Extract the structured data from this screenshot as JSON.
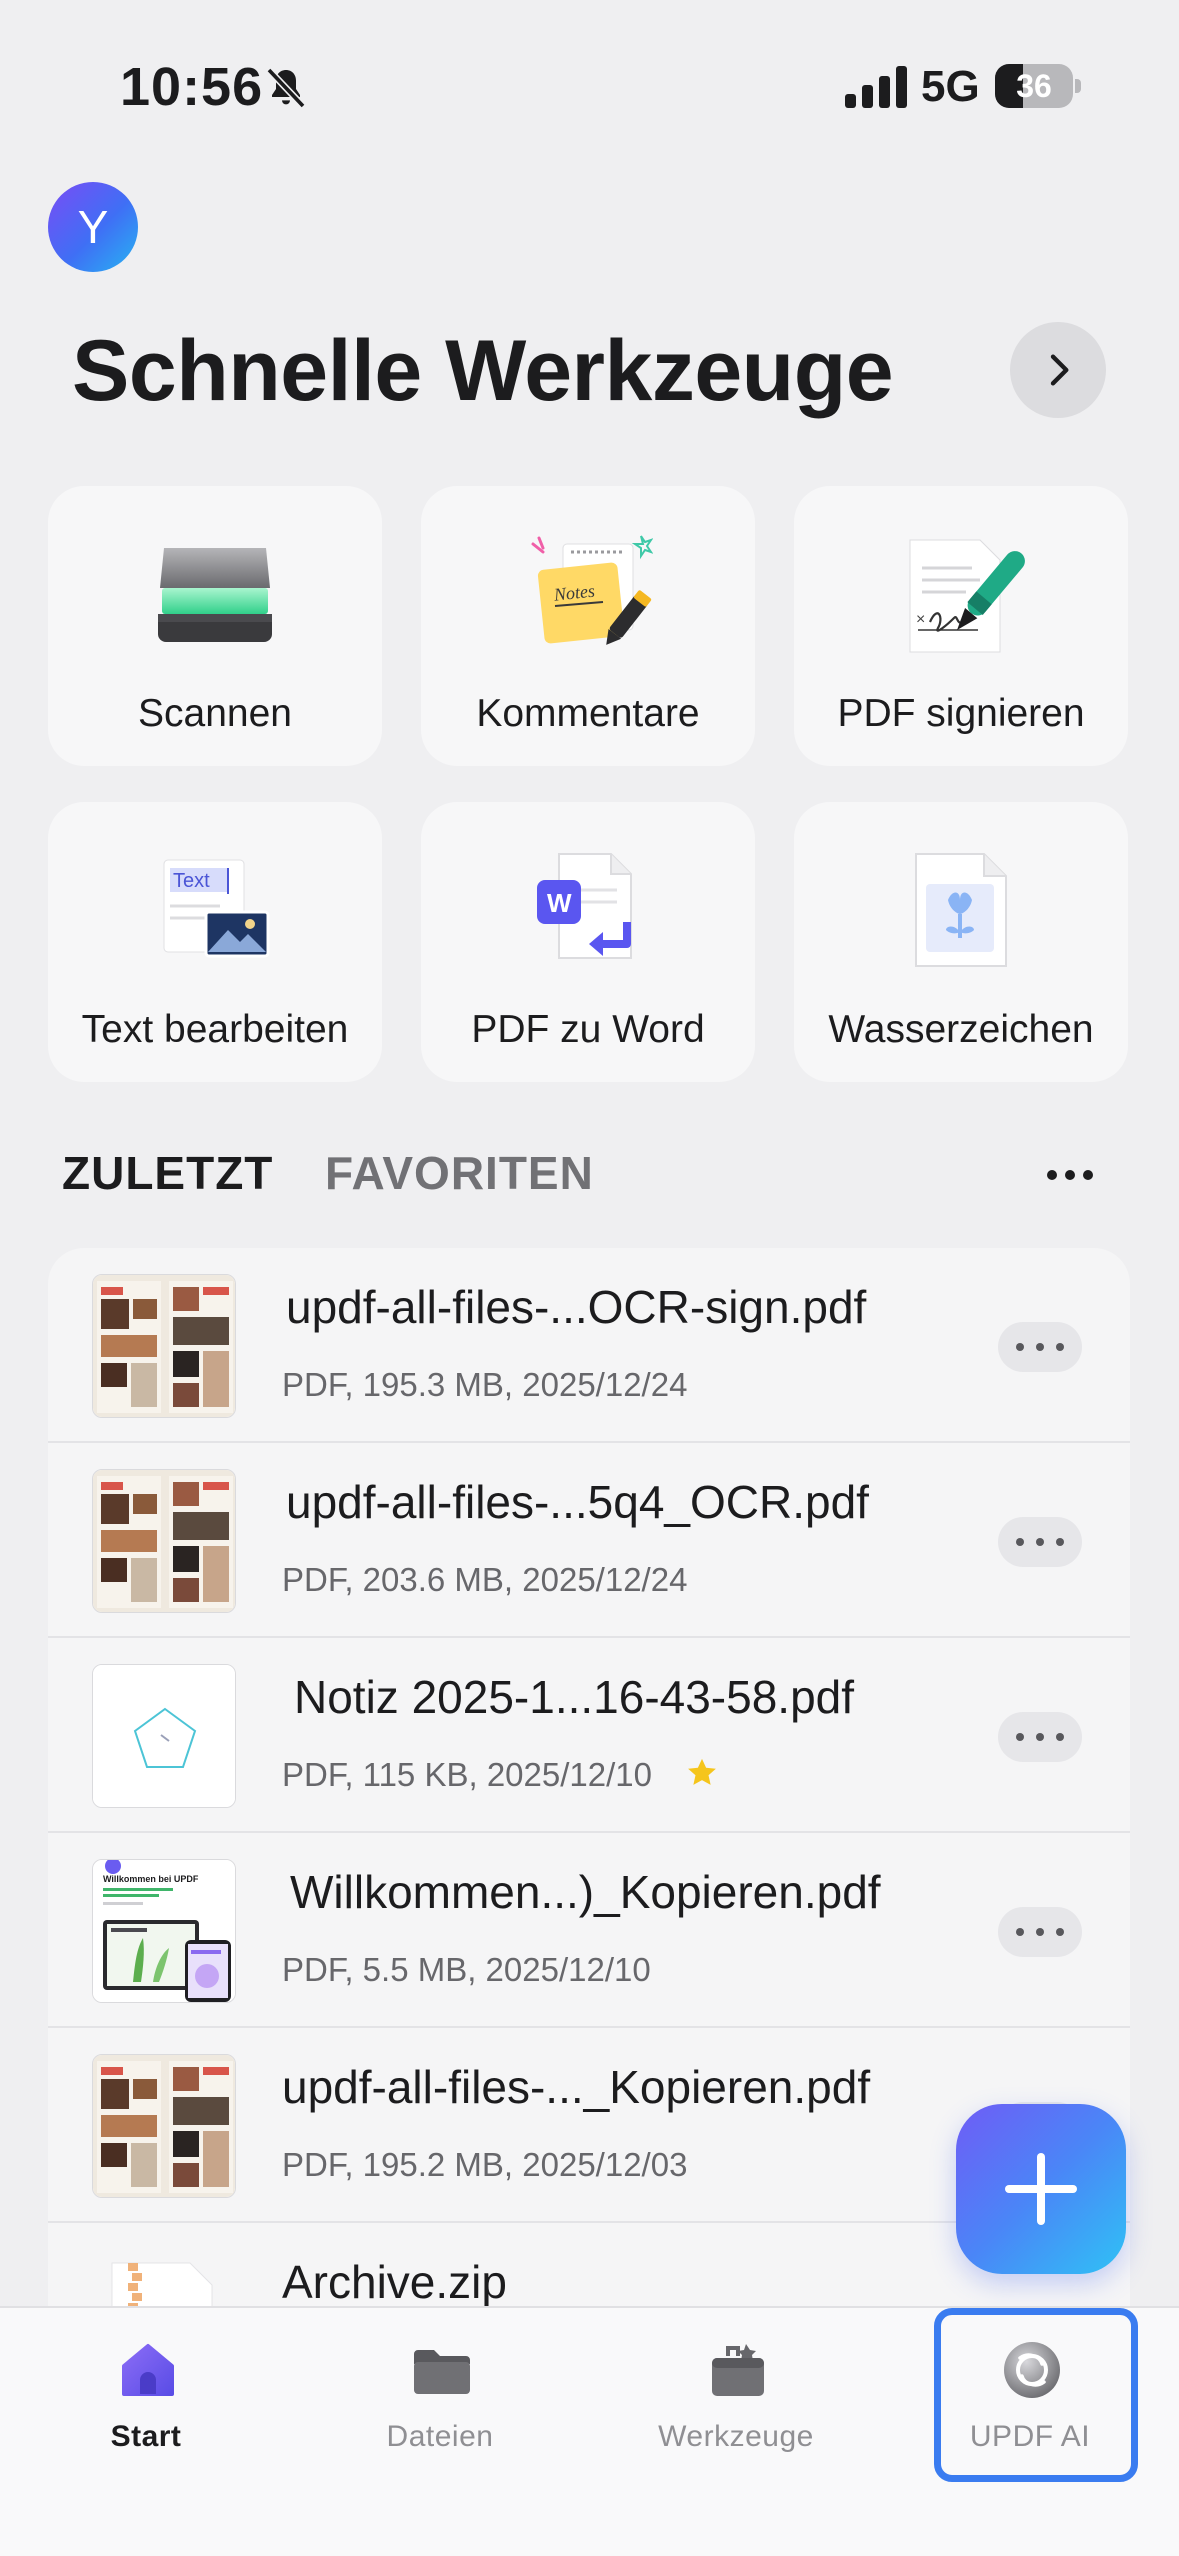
{
  "status_bar": {
    "time": "10:56",
    "network": "5G",
    "battery": "36",
    "battery_level": 0.36
  },
  "header": {
    "avatar_letter": "Y",
    "title": "Schnelle Werkzeuge"
  },
  "tools": [
    {
      "label": "Scannen",
      "icon": "scanner-icon"
    },
    {
      "label": "Kommentare",
      "icon": "notes-icon",
      "icon_text": "Notes"
    },
    {
      "label": "PDF signieren",
      "icon": "signature-pen-icon"
    },
    {
      "label": "Text bearbeiten",
      "icon": "edit-text-icon",
      "icon_text": "Text"
    },
    {
      "label": "PDF zu Word",
      "icon": "word-convert-icon",
      "icon_text": "W"
    },
    {
      "label": "Wasserzeichen",
      "icon": "watermark-icon"
    }
  ],
  "tabs": {
    "recent": "ZULETZT",
    "favorites": "FAVORITEN"
  },
  "files": [
    {
      "name": "updf-all-files-...OCR-sign.pdf",
      "meta": "PDF, 195.3 MB, 2025/12/24",
      "favorite": false
    },
    {
      "name": "updf-all-files-...5q4_OCR.pdf",
      "meta": "PDF, 203.6 MB, 2025/12/24",
      "favorite": false
    },
    {
      "name": "Notiz 2025-1...16-43-58.pdf",
      "meta": "PDF, 115 KB, 2025/12/10",
      "favorite": true
    },
    {
      "name": "Willkommen...)_Kopieren.pdf",
      "meta": "PDF, 5.5 MB, 2025/12/10",
      "favorite": false,
      "thumb_title": "Willkommen bei UPDF"
    },
    {
      "name": "updf-all-files-..._Kopieren.pdf",
      "meta": "PDF, 195.2 MB, 2025/12/03",
      "favorite": false
    },
    {
      "name": "Archive.zip",
      "meta": "",
      "favorite": false
    }
  ],
  "tab_bar": [
    {
      "label": "Start",
      "icon": "home-icon",
      "active": true
    },
    {
      "label": "Dateien",
      "icon": "folder-icon",
      "active": false
    },
    {
      "label": "Werkzeuge",
      "icon": "toolbox-icon",
      "active": false
    },
    {
      "label": "UPDF AI",
      "icon": "ai-icon",
      "active": false,
      "highlighted": true
    }
  ],
  "colors": {
    "accent": "#3a7cf0",
    "fab_start": "#6f5cf6",
    "fab_end": "#2fc2f5",
    "star": "#f5c51c"
  }
}
